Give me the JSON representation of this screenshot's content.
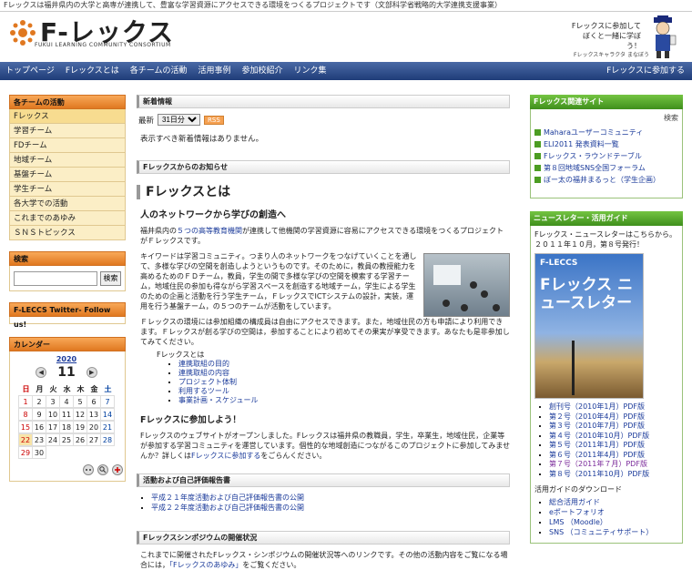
{
  "top_strip": "Fレックスは福井県内の大学と高専が連携して、豊富な学習資源にアクセスできる環境をつくるプロジェクトです（文部科学省戦略的大学連携支援事業）",
  "header": {
    "logo_title": "F-レックス",
    "logo_sub": "FUKUI LEARNING COMMUNITY CONSORTIUM",
    "mascot_speech": "Fレックスに参加して ぼくと一緒に学ぼう！",
    "mascot_caption": "Fレックスキャラクタ まなぼう"
  },
  "nav": {
    "items": [
      "トップページ",
      "Fレックスとは",
      "各チームの活動",
      "活用事例",
      "参加校紹介",
      "リンク集"
    ],
    "join": "Fレックスに参加する"
  },
  "left": {
    "teams_title": "各チームの活動",
    "menu": [
      "Fレックス",
      "学習チーム",
      "FDチーム",
      "地域チーム",
      "基盤チーム",
      "学生チーム",
      "各大学での活動",
      "これまでのあゆみ",
      "ＳＮＳトピックス"
    ],
    "search_title": "検索",
    "search_button": "検索",
    "search_value": "",
    "twitter_title": "F-LECCS Twitter- Follow us!",
    "calendar_title": "カレンダー",
    "calendar": {
      "year": "2020",
      "month": "11",
      "prev": "◀",
      "next": "▶",
      "weekdays": [
        "日",
        "月",
        "火",
        "水",
        "木",
        "金",
        "土"
      ],
      "days": [
        "1",
        "2",
        "3",
        "4",
        "5",
        "6",
        "7",
        "8",
        "9",
        "10",
        "11",
        "12",
        "13",
        "14",
        "15",
        "16",
        "17",
        "18",
        "19",
        "20",
        "21",
        "22",
        "23",
        "24",
        "25",
        "26",
        "27",
        "28",
        "29",
        "30"
      ],
      "today": "22"
    }
  },
  "center": {
    "whatsnew_title": "新着情報",
    "latest_label": "最新",
    "latest_option": "31日分",
    "rss": "RSS",
    "whatsnew_msg": "表示すべき新着情報はありません。",
    "info_title": "Fレックスからのお知らせ",
    "fl_title": "Fレックスとは",
    "fl_sub": "人のネットワークから学びの創造へ",
    "p1_pre": "福井県内の",
    "p1_link": "５つの高等教育機関",
    "p1_post": "が連携して他機関の学習資源に容易にアクセスできる環境をつくるプロジェクトがＦレックスです。",
    "p2": "キイワードは学習コミュニティ。つまり人のネットワークをつなげていくことを通して、多様な学びの空間を創造しようというものです。そのために，教員の教授能力を高めるためのＦＤチーム，教員，学生の間で多様な学びの空間を模索する学習チーム，地域住民の参加も得ながら学習スペースを創造する地域チーム，学生による学生のための企画と活動を行う学生チーム，ＦレックスでICTシステムの設計，実装，運用を行う基盤チーム，の５つのチームが活動をしています。",
    "p3": "Ｆレックスの環境には参加組織の構成員は自由にアクセスできます。また，地域住民の方も申請により利用できます。Ｆレックスが創る学びの空間は，参加することにより初めてその果実が享受できます。あなたも是非参加してみてください。",
    "list_root": "Fレックスとは",
    "list": [
      "連携取組の目的",
      "連携取組の内容",
      "プロジェクト体制",
      "利用するツール",
      "事業計画・スケジュール"
    ],
    "join_title": "Fレックスに参加しよう！",
    "join_p_pre": "Fレックスのウェブサイトがオープンしました。Fレックスは福井県の教職員，学生，卒業生，地域住民，企業等が参加する学習コミュニティを運営しています。個性的な地域創造につながるこのプロジェクトに参加してみませんか？詳しくは",
    "join_link": "Fレックスに参加する",
    "join_p_post": "をごらんください。",
    "eval_title": "活動および自己評価報告書",
    "eval": [
      "平成２１年度活動および自己評価報告書の公開",
      "平成２２年度活動および自己評価報告書の公開"
    ],
    "sym_title": "Fレックスシンポジウムの開催状況",
    "sym_p_pre": "これまでに開催されたFレックス・シンポジウムの開催状況等へのリンクです。その他の活動内容をご覧になる場合には，",
    "sym_link": "「Fレックスのあゆみ」",
    "sym_p_post": "をご覧ください。"
  },
  "right": {
    "rel_title": "Fレックス関連サイト",
    "rel_search": "検索",
    "rel": [
      "Maharaユーザーコミュニティ",
      "ELI2011 発表資料一覧",
      "Fレックス・ラウンドテーブル",
      "第８回地域SNS全国フォーラム",
      "ぼー太の福井まるっと（学生企画）"
    ],
    "nl_title": "ニュースレター・活用ガイド",
    "nl_text": "Fレックス・ニュースレターはこちらから。２０１１年１０月，第８号発行！",
    "nl_cover_logo": "F-LECCS",
    "nl_cover_title": "Fレックス ニュースレター",
    "nl_issues": [
      "創刊号（2010年1月）PDF版",
      "第２号（2010年4月）PDF版",
      "第３号（2010年7月）PDF版",
      "第４号（2010年10月）PDF版",
      "第５号（2011年1月）PDF版",
      "第６号（2011年4月）PDF版",
      "第７号（2011年７月）PDF版",
      "第８号（2011年10月）PDF版"
    ],
    "dl_label": "活用ガイドのダウンロード",
    "dl": [
      "総合活用ガイド",
      "eポートフォリオ",
      "LMS （Moodle）",
      "SNS （コミュニティサポート）"
    ]
  },
  "colors": {
    "nav": "#1f3c78",
    "orange": "#e07820",
    "green": "#3f8f1c",
    "menu_bg": "#fbeec6"
  }
}
